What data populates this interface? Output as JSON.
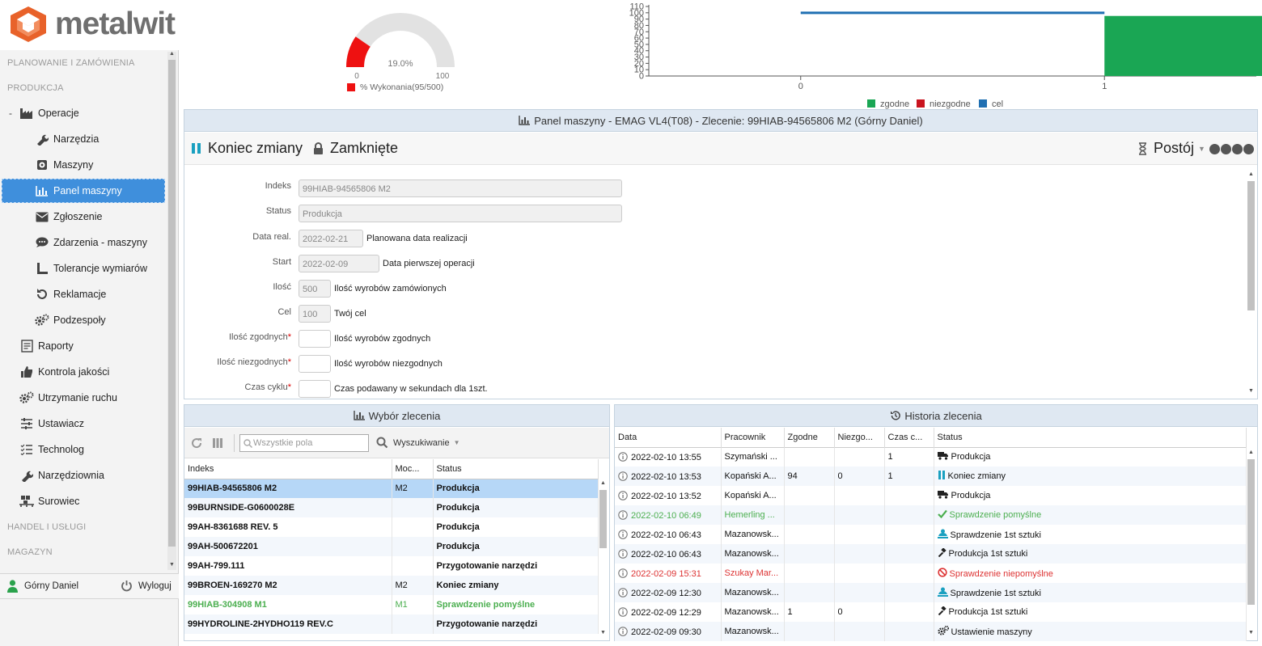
{
  "app": {
    "logo_text": "metalwit",
    "brand_color": "#e8622a",
    "accent": "#3f8fdc"
  },
  "sidebar": {
    "sections": [
      "PLANOWANIE I ZAMÓWIENIA",
      "PRODUKCJA",
      "HANDEL I USŁUGI",
      "MAGAZYN"
    ],
    "collapse_marker": "-",
    "items": [
      {
        "label": "Operacje",
        "icon": "factory-icon"
      },
      {
        "label": "Narzędzia",
        "icon": "wrench-icon"
      },
      {
        "label": "Maszyny",
        "icon": "machine-icon"
      },
      {
        "label": "Panel maszyny",
        "icon": "chart-icon"
      },
      {
        "label": "Zgłoszenie",
        "icon": "envelope-icon"
      },
      {
        "label": "Zdarzenia - maszyny",
        "icon": "chat-icon"
      },
      {
        "label": "Tolerancje wymiarów",
        "icon": "ruler-icon"
      },
      {
        "label": "Reklamacje",
        "icon": "undo-icon"
      },
      {
        "label": "Podzespoły",
        "icon": "gears-icon"
      },
      {
        "label": "Raporty",
        "icon": "report-icon"
      },
      {
        "label": "Kontrola jakości",
        "icon": "thumbs-up-icon"
      },
      {
        "label": "Utrzymanie ruchu",
        "icon": "gears-icon"
      },
      {
        "label": "Ustawiacz",
        "icon": "sliders-icon"
      },
      {
        "label": "Technolog",
        "icon": "list-icon"
      },
      {
        "label": "Narzędziownia",
        "icon": "wrench-icon"
      },
      {
        "label": "Surowiec",
        "icon": "pallet-icon"
      }
    ],
    "user_name": "Górny Daniel",
    "logout_label": "Wyloguj"
  },
  "gauge": {
    "value_text": "19.0%",
    "min": "0",
    "max": "100",
    "legend": "% Wykonania(95/500)",
    "fraction": 0.19,
    "color": "#ee1111"
  },
  "chart_data": {
    "type": "bar",
    "x_ticks": [
      "0",
      "1"
    ],
    "y_ticks": [
      "0",
      "10",
      "20",
      "30",
      "40",
      "50",
      "60",
      "70",
      "80",
      "90",
      "100",
      "110"
    ],
    "ylim": [
      0,
      110
    ],
    "series": [
      {
        "name": "zgodne",
        "color": "#1aa654",
        "x": 1,
        "value": 95
      },
      {
        "name": "niezgodne",
        "color": "#c9141f",
        "x": 1,
        "value": 0
      },
      {
        "name": "cel",
        "color": "#1f6fb2",
        "type": "line",
        "x": [
          0,
          1
        ],
        "value": 100
      }
    ],
    "legend_position": "bottom"
  },
  "panel": {
    "title": "Panel maszyny - EMAG VL4(T08) - Zlecenie: 99HIAB-94565806 M2 (Górny Daniel)",
    "btn_end_shift": "Koniec zmiany",
    "btn_closed": "Zamknięte",
    "btn_downtime": "Postój",
    "form": [
      {
        "label": "Indeks",
        "value": "99HIAB-94565806 M2",
        "desc": "",
        "required": false
      },
      {
        "label": "Status",
        "value": "Produkcja",
        "desc": "",
        "required": false
      },
      {
        "label": "Data real.",
        "value": "2022-02-21",
        "desc": "Planowana data realizacji",
        "required": false
      },
      {
        "label": "Start",
        "value": "2022-02-09",
        "desc": "Data pierwszej operacji",
        "required": false
      },
      {
        "label": "Ilość",
        "value": "500",
        "desc": "Ilość wyrobów zamówionych",
        "required": false
      },
      {
        "label": "Cel",
        "value": "100",
        "desc": "Twój cel",
        "required": false
      },
      {
        "label": "Ilość zgodnych",
        "value": "",
        "desc": "Ilość wyrobów zgodnych",
        "required": true
      },
      {
        "label": "Ilość niezgodnych",
        "value": "",
        "desc": "Ilość wyrobów niezgodnych",
        "required": true
      },
      {
        "label": "Czas cyklu",
        "value": "",
        "desc": "Czas podawany w sekundach dla 1szt.",
        "required": true
      }
    ],
    "required_marker": "*"
  },
  "orders": {
    "title": "Wybór zlecenia",
    "search_placeholder": "Wszystkie pola",
    "search_label": "Wyszukiwanie",
    "columns": [
      "Indeks",
      "Moc...",
      "Status"
    ],
    "rows": [
      {
        "indeks": "99HIAB-94565806 M2",
        "moc": "M2",
        "status": "Produkcja",
        "style": "selected"
      },
      {
        "indeks": "99BURNSIDE-G0600028E",
        "moc": "",
        "status": "Produkcja",
        "style": ""
      },
      {
        "indeks": "99AH-8361688 REV. 5",
        "moc": "",
        "status": "Produkcja",
        "style": ""
      },
      {
        "indeks": "99AH-500672201",
        "moc": "",
        "status": "Produkcja",
        "style": ""
      },
      {
        "indeks": "99AH-799.111",
        "moc": "",
        "status": "Przygotowanie narzędzi",
        "style": ""
      },
      {
        "indeks": "99BROEN-169270 M2",
        "moc": "M2",
        "status": "Koniec zmiany",
        "style": ""
      },
      {
        "indeks": "99HIAB-304908 M1",
        "moc": "M1",
        "status": "Sprawdzenie pomyślne",
        "style": "green"
      },
      {
        "indeks": "99HYDROLINE-2HYDHO119 REV.C",
        "moc": "",
        "status": "Przygotowanie narzędzi",
        "style": ""
      }
    ]
  },
  "history": {
    "title": "Historia zlecenia",
    "columns": [
      "Data",
      "Pracownik",
      "Zgodne",
      "Niezgo...",
      "Czas c...",
      "Status"
    ],
    "rows": [
      {
        "data": "2022-02-10 13:55",
        "pracownik": "Szymański ...",
        "zgodne": "",
        "niezgodne": "",
        "czas": "1",
        "status": "Produkcja",
        "icon": "truck-icon",
        "style": ""
      },
      {
        "data": "2022-02-10 13:53",
        "pracownik": "Kopański A...",
        "zgodne": "94",
        "niezgodne": "0",
        "czas": "1",
        "status": "Koniec zmiany",
        "icon": "pause-icon",
        "style": ""
      },
      {
        "data": "2022-02-10 13:52",
        "pracownik": "Kopański A...",
        "zgodne": "",
        "niezgodne": "",
        "czas": "",
        "status": "Produkcja",
        "icon": "truck-icon",
        "style": ""
      },
      {
        "data": "2022-02-10 06:49",
        "pracownik": "Hemerling ...",
        "zgodne": "",
        "niezgodne": "",
        "czas": "",
        "status": "Sprawdzenie pomyślne",
        "icon": "check-icon",
        "style": "green"
      },
      {
        "data": "2022-02-10 06:43",
        "pracownik": "Mazanowsk...",
        "zgodne": "",
        "niezgodne": "",
        "czas": "",
        "status": "Sprawdzenie 1st sztuki",
        "icon": "inspector-icon",
        "style": ""
      },
      {
        "data": "2022-02-10 06:43",
        "pracownik": "Mazanowsk...",
        "zgodne": "",
        "niezgodne": "",
        "czas": "",
        "status": "Produkcja 1st sztuki",
        "icon": "hammer-icon",
        "style": ""
      },
      {
        "data": "2022-02-09 15:31",
        "pracownik": "Szukay Mar...",
        "zgodne": "",
        "niezgodne": "",
        "czas": "",
        "status": "Sprawdzenie niepomyślne",
        "icon": "ban-icon",
        "style": "red"
      },
      {
        "data": "2022-02-09 12:30",
        "pracownik": "Mazanowsk...",
        "zgodne": "",
        "niezgodne": "",
        "czas": "",
        "status": "Sprawdzenie 1st sztuki",
        "icon": "inspector-icon",
        "style": ""
      },
      {
        "data": "2022-02-09 12:29",
        "pracownik": "Mazanowsk...",
        "zgodne": "1",
        "niezgodne": "0",
        "czas": "",
        "status": "Produkcja 1st sztuki",
        "icon": "hammer-icon",
        "style": ""
      },
      {
        "data": "2022-02-09 09:30",
        "pracownik": "Mazanowsk...",
        "zgodne": "",
        "niezgodne": "",
        "czas": "",
        "status": "Ustawienie maszyny",
        "icon": "gears-icon",
        "style": ""
      }
    ]
  }
}
